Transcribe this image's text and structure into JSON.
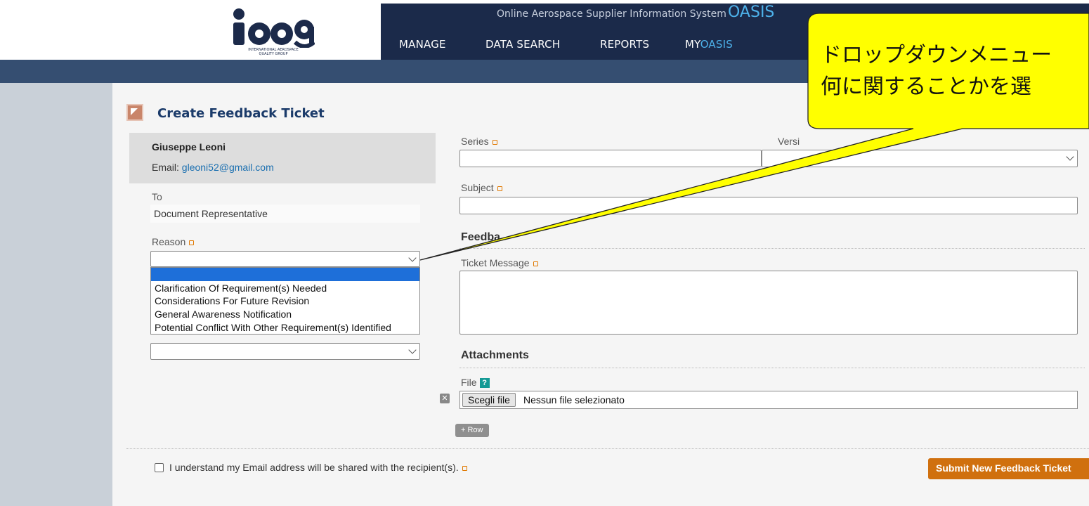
{
  "header": {
    "logo_text": "iaqg",
    "logo_caption": "INTERNATIONAL AEROSPACE QUALITY GROUP",
    "tagline": "Online Aerospace Supplier Information System",
    "tagline_brand": "OASIS",
    "nav": {
      "manage": "MANAGE",
      "data_search": "DATA SEARCH",
      "reports": "REPORTS",
      "my_prefix": "MY",
      "my_suffix": "OASIS"
    }
  },
  "page": {
    "title": "Create Feedback Ticket"
  },
  "user": {
    "name": "Giuseppe Leoni",
    "email_label": "Email: ",
    "email": "gleoni52@gmail.com"
  },
  "form": {
    "to_label": "To",
    "to_value": "Document Representative",
    "reason_label": "Reason",
    "reason_selected": "",
    "reason_options": [
      "",
      "Clarification Of Requirement(s) Needed",
      "Considerations For Future Revision",
      "General Awareness Notification",
      "Potential Conflict With Other Requirement(s) Identified"
    ],
    "series_label": "Series",
    "version_label": "Versi",
    "subject_label": "Subject",
    "feedback_heading": "Feedba",
    "ticket_message_label": "Ticket Message",
    "attachments_heading": "Attachments",
    "file_label": "File",
    "file_help": "?",
    "file_button": "Scegli file",
    "file_status": "Nessun file selezionato",
    "file_remove": "✕",
    "add_row": "+ Row",
    "consent_text": "I understand my Email address will be shared with the recipient(s).",
    "submit": "Submit New Feedback Ticket"
  },
  "callout": {
    "line1": "ドロップダウンメニュー",
    "line2": "何に関することかを選",
    "fill": "#ffff00"
  },
  "colors": {
    "navbar": "#1b2a4a",
    "subbar": "#354e71",
    "accent": "#4db1ea",
    "submit": "#d0700e",
    "required": "#e07800",
    "highlight": "#1e6fd9"
  }
}
